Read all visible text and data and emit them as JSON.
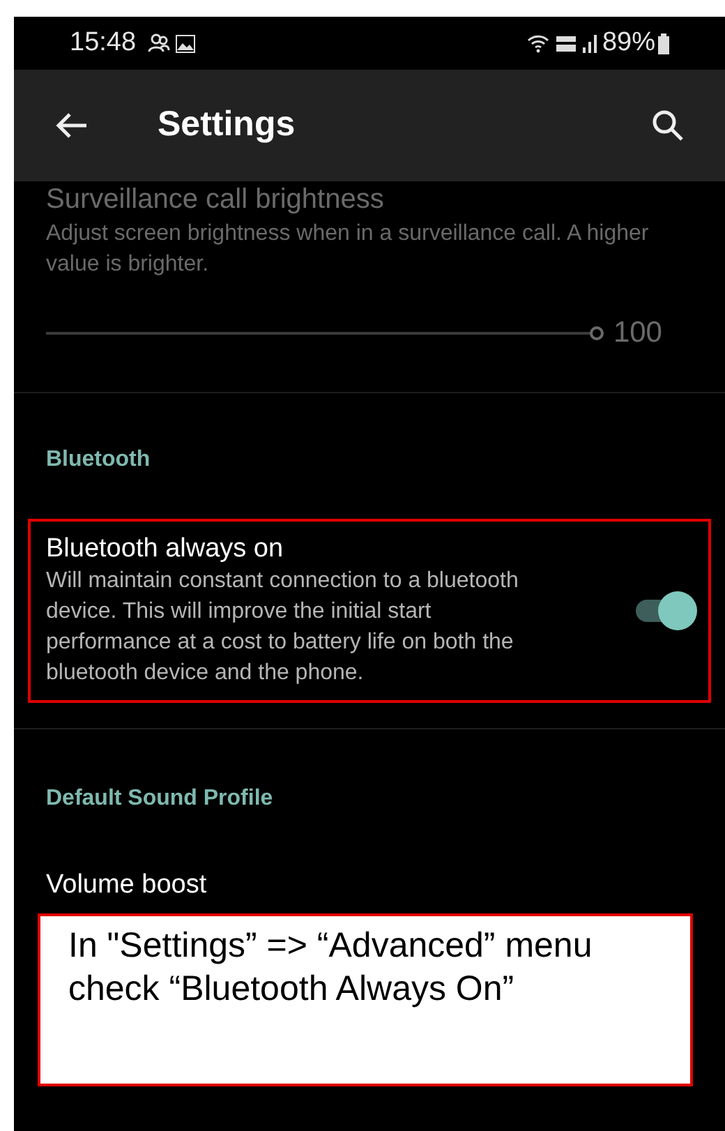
{
  "status_bar": {
    "time": "15:48",
    "battery": "89%"
  },
  "toolbar": {
    "title": "Settings"
  },
  "sections": [
    {
      "kind": "slider",
      "title": "Surveillance call brightness",
      "description": "Adjust screen brightness when in a surveillance call. A higher value is brighter.",
      "level": 1.0,
      "reading": "100"
    },
    {
      "kind": "header",
      "title": "Bluetooth"
    },
    {
      "kind": "switch",
      "title": "Bluetooth always on",
      "description": "Will maintain constant connection to a bluetooth device. This will improve the initial start performance at a cost to battery life on both the bluetooth device and the phone.",
      "checked": true,
      "highlighted": true
    },
    {
      "kind": "header",
      "title": "Default Sound Profile"
    },
    {
      "kind": "plain",
      "title": "Volume boost"
    }
  ],
  "annotation": {
    "text": "In \"Settings” => “Advanced” menu check “Bluetooth Always On”"
  }
}
